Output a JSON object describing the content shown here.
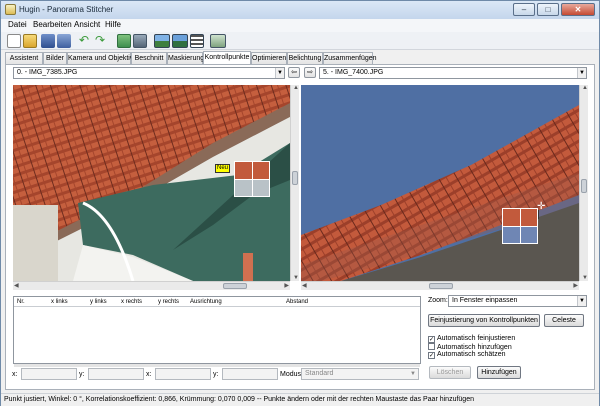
{
  "window": {
    "title": "Hugin - Panorama Stitcher"
  },
  "menubar": [
    "Datei",
    "Bearbeiten",
    "Ansicht",
    "Hilfe"
  ],
  "toolbar": {
    "icons": [
      "new-project-icon",
      "open-project-icon",
      "save-project-icon",
      "save-as-icon",
      "undo-icon",
      "redo-icon",
      "add-images-icon",
      "optimize-icon",
      "preview-icon",
      "fast-preview-icon",
      "layout-icon",
      "stitch-icon"
    ]
  },
  "tabs": [
    "Assistent",
    "Bilder",
    "Kamera und Objektiv",
    "Beschnitt",
    "Maskierung",
    "Kontrollpunkte",
    "Optimieren",
    "Belichtung",
    "Zusammenfügen"
  ],
  "active_tab": "Kontrollpunkte",
  "left_image": {
    "selected": "0. - IMG_7385.JPG"
  },
  "right_image": {
    "selected": "5. - IMG_7400.JPG"
  },
  "point_label": "Neu",
  "table": {
    "columns": [
      "Nr.",
      "x links",
      "y links",
      "x rechts",
      "y rechts",
      "Ausrichtung",
      "Abstand"
    ]
  },
  "coords": {
    "x1": "x:",
    "y1": "y:",
    "x2": "x:",
    "y2": "y:",
    "mode_label": "Modus:",
    "mode_value": "Standard"
  },
  "zoom": {
    "label": "Zoom:",
    "value": "In Fenster einpassen"
  },
  "buttons": {
    "fine_tune": "Feinjustierung von Kontrollpunkten",
    "celeste": "Celeste",
    "delete": "Löschen",
    "add": "Hinzufügen"
  },
  "checkboxes": [
    {
      "label": "Automatisch feinjustieren",
      "checked": true
    },
    {
      "label": "Automatisch hinzufügen",
      "checked": false
    },
    {
      "label": "Automatisch schätzen",
      "checked": true
    }
  ],
  "status": "Punkt justiert, Winkel: 0 °, Korrelationskoeffizient: 0,866, Krümmung: 0,070 0,009 -- Punkte ändern oder mit der rechten Maustaste das Paar hinzufügen",
  "colors": {
    "accent": "#3a7bd5",
    "roof": "#a8452e",
    "awning": "#3d6b5f",
    "sky": "#4f6fa3",
    "label": "#ffff00"
  }
}
